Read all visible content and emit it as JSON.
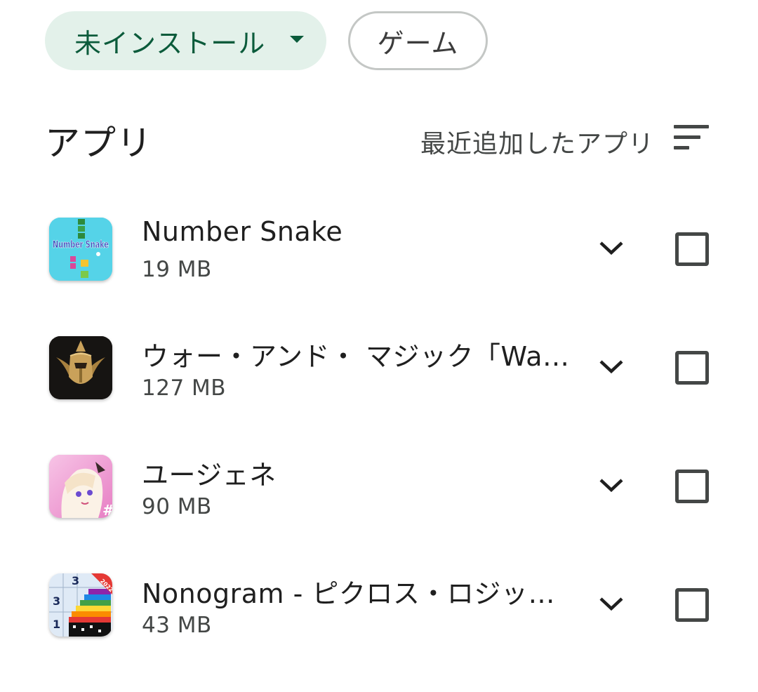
{
  "filters": {
    "install_status": "未インストール",
    "category": "ゲーム"
  },
  "section": {
    "title": "アプリ",
    "sort_label": "最近追加したアプリ"
  },
  "icons": {
    "dropdown": "arrow-drop-down-icon",
    "sort": "sort-icon",
    "expand": "chevron-down-icon",
    "checkbox": "checkbox-unchecked-icon"
  },
  "apps": [
    {
      "name": "Number Snake",
      "size": "19 MB",
      "icon_text": "Number Snake"
    },
    {
      "name": "ウォー・アンド・ マジック「War...",
      "size": "127 MB"
    },
    {
      "name": "ユージェネ",
      "size": "90 MB"
    },
    {
      "name": "Nonogram - ピクロス・ロジック...",
      "size": "43 MB",
      "icon_text": [
        "3",
        "3",
        "1",
        "2022"
      ]
    }
  ],
  "colors": {
    "chip_active_bg": "#e3f1ea",
    "chip_active_text": "#0b5b3b",
    "icon_grey": "#444746"
  }
}
